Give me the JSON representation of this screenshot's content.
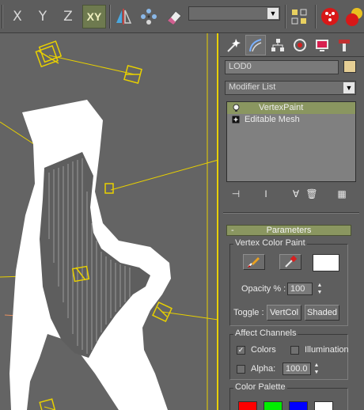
{
  "toolbar": {
    "axes": [
      "X",
      "Y",
      "Z",
      "XY"
    ],
    "active_axis": "XY",
    "named_selection_value": ""
  },
  "viewport": {
    "frame_color": "#e8d000",
    "object_color": "#ffffff",
    "light_color": "#e8d000"
  },
  "panel": {
    "tabs": [
      "create-tab",
      "modify-tab",
      "hierarchy-tab",
      "motion-tab",
      "display-tab",
      "utilities-tab"
    ],
    "active_tab": "modify-tab",
    "object_name": "LOD0",
    "object_color": "#e6cf95",
    "modifier_list": "Modifier List",
    "stack": [
      {
        "label": "VertexPaint",
        "selected": true,
        "icon": "lightbulb-icon"
      },
      {
        "label": "Editable Mesh",
        "selected": false,
        "icon": "expand-plus-icon"
      }
    ],
    "rollout": {
      "title": "Parameters",
      "collapse_symbol": "-",
      "vertex_color_paint": {
        "group_label": "Vertex Color Paint",
        "paint_color": "#ffffff",
        "opacity_label": "Opacity % :",
        "opacity_value": "100",
        "toggle_label": "Toggle :",
        "vertcol_label": "VertCol",
        "shaded_label": "Shaded"
      },
      "affect_channels": {
        "group_label": "Affect Channels",
        "colors_label": "Colors",
        "colors_checked": true,
        "illumination_label": "Illumination",
        "illumination_checked": false,
        "alpha_label": "Alpha:",
        "alpha_checked": false,
        "alpha_value": "100.0"
      },
      "color_palette": {
        "group_label": "Color Palette",
        "swatches": [
          "#ff0000",
          "#00ee00",
          "#0000ff",
          "#ffffff"
        ]
      }
    }
  }
}
